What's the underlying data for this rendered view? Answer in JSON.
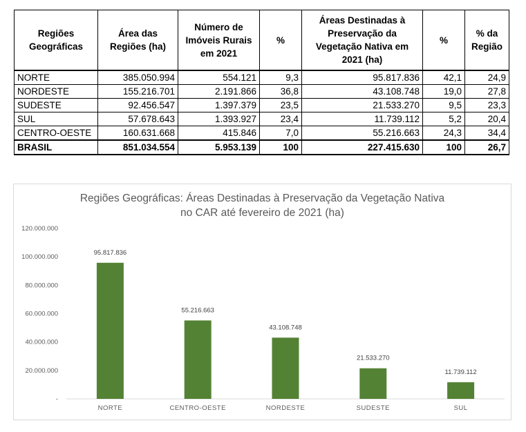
{
  "table": {
    "headers": [
      "Regiões Geográficas",
      "Área das Regiões (ha)",
      "Número de Imóveis Rurais em 2021",
      "%",
      "Áreas Destinadas à Preservação da Vegetação Nativa em 2021 (ha)",
      "%",
      "% da Região"
    ],
    "rows": [
      [
        "NORTE",
        "385.050.994",
        "554.121",
        "9,3",
        "95.817.836",
        "42,1",
        "24,9"
      ],
      [
        "NORDESTE",
        "155.216.701",
        "2.191.866",
        "36,8",
        "43.108.748",
        "19,0",
        "27,8"
      ],
      [
        "SUDESTE",
        "92.456.547",
        "1.397.379",
        "23,5",
        "21.533.270",
        "9,5",
        "23,3"
      ],
      [
        "SUL",
        "57.678.643",
        "1.393.927",
        "23,4",
        "11.739.112",
        "5,2",
        "20,4"
      ],
      [
        "CENTRO-OESTE",
        "160.631.668",
        "415.846",
        "7,0",
        "55.216.663",
        "24,3",
        "34,4"
      ]
    ],
    "total": [
      "BRASIL",
      "851.034.554",
      "5.953.139",
      "100",
      "227.415.630",
      "100",
      "26,7"
    ]
  },
  "chart_data": {
    "type": "bar",
    "title": "Regiões Geográficas: Áreas Destinadas à Preservação da Vegetação Nativa no CAR até fevereiro de 2021 (ha)",
    "title_lines": [
      "Regiões Geográficas: Áreas Destinadas à Preservação da Vegetação Nativa",
      "no CAR até fevereiro de 2021 (ha)"
    ],
    "categories": [
      "NORTE",
      "CENTRO-OESTE",
      "NORDESTE",
      "SUDESTE",
      "SUL"
    ],
    "values": [
      95817836,
      55216663,
      43108748,
      21533270,
      11739112
    ],
    "data_labels": [
      "95.817.836",
      "55.216.663",
      "43.108.748",
      "21.533.270",
      "11.739.112"
    ],
    "y_ticks": [
      0,
      20000000,
      40000000,
      60000000,
      80000000,
      100000000,
      120000000
    ],
    "y_tick_labels": [
      "-",
      "20.000.000",
      "40.000.000",
      "60.000.000",
      "80.000.000",
      "100.000.000",
      "120.000.000"
    ],
    "ylim": [
      0,
      120000000
    ],
    "xlabel": "",
    "ylabel": "",
    "grid": false,
    "legend": "none",
    "bar_color": "#548235"
  }
}
